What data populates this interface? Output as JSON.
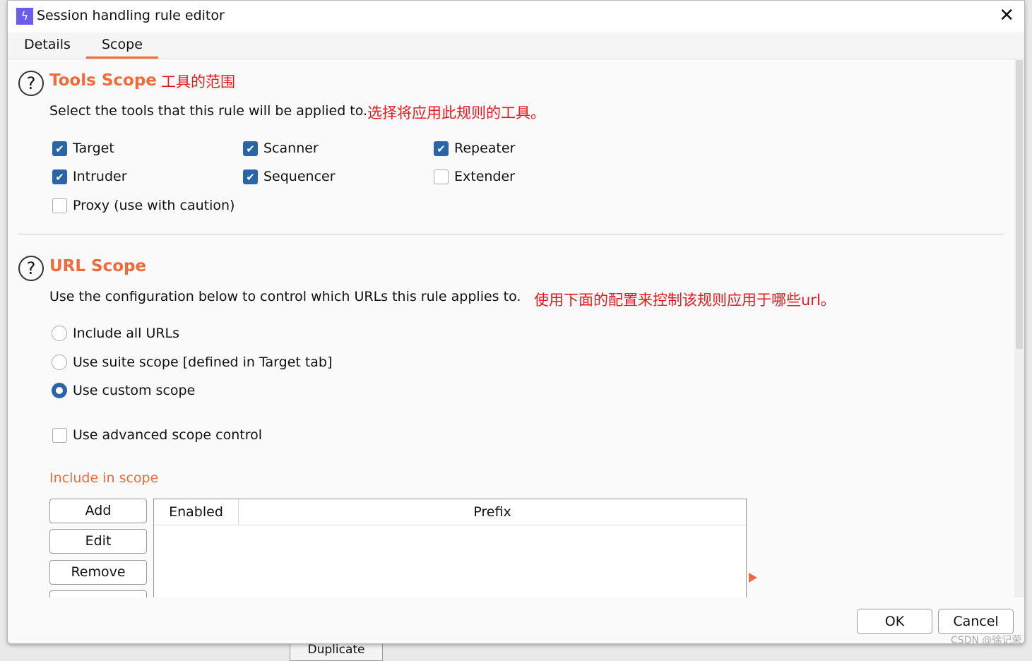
{
  "background": {
    "button": "Duplicate"
  },
  "dialog": {
    "title": "Session handling rule editor",
    "tabs": [
      "Details",
      "Scope"
    ],
    "tools": {
      "heading": "Tools Scope",
      "heading_note": "工具的范围",
      "desc": "Select the tools that this rule will be applied to.",
      "desc_note": "选择将应用此规则的工具。",
      "items": [
        {
          "label": "Target",
          "checked": true
        },
        {
          "label": "Scanner",
          "checked": true
        },
        {
          "label": "Repeater",
          "checked": true
        },
        {
          "label": "Intruder",
          "checked": true
        },
        {
          "label": "Sequencer",
          "checked": true
        },
        {
          "label": "Extender",
          "checked": false
        },
        {
          "label": "Proxy (use with caution)",
          "checked": false
        }
      ]
    },
    "url": {
      "heading": "URL Scope",
      "desc": "Use the configuration below to control which URLs this rule applies to.",
      "desc_note": "使用下面的配置来控制该规则应用于哪些url。",
      "options": [
        {
          "label": "Include all URLs",
          "selected": false
        },
        {
          "label": "Use suite scope [defined in Target tab]",
          "selected": false
        },
        {
          "label": "Use custom scope",
          "selected": true
        }
      ],
      "advanced": {
        "label": "Use advanced scope control",
        "checked": false
      },
      "include_label": "Include in scope",
      "buttons": [
        "Add",
        "Edit",
        "Remove"
      ],
      "columns": [
        "Enabled",
        "Prefix"
      ]
    },
    "footer": {
      "ok": "OK",
      "cancel": "Cancel"
    },
    "watermark": "CSDN @徐记荣",
    "accent": "#f06a3b",
    "check_color": "#2a65a8"
  }
}
